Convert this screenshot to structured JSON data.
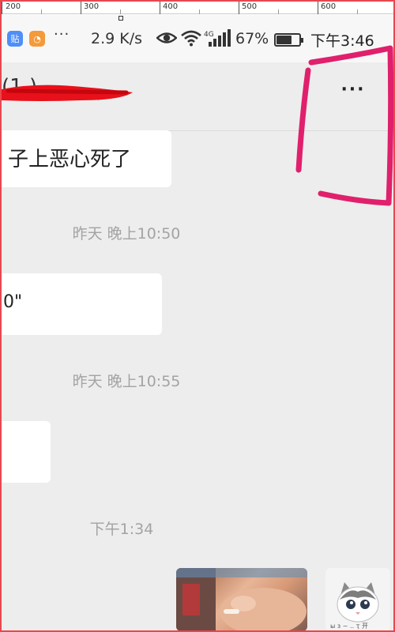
{
  "ruler": {
    "labels": [
      "200",
      "300",
      "400",
      "500",
      "600"
    ]
  },
  "status_bar": {
    "app_icons": [
      {
        "name": "tieba-app-icon",
        "glyph": "贴",
        "color": "#4f8ef7"
      },
      {
        "name": "uc-browser-app-icon",
        "glyph": "◔",
        "color": "#f39a3a"
      }
    ],
    "more_notifications": "···",
    "network_speed": "2.9 K/s",
    "network_type": "4G",
    "battery_percent": "67%",
    "battery_level": 0.67,
    "time": "下午3:46"
  },
  "title_bar": {
    "title": "(1 )",
    "more_label": "···"
  },
  "chat": {
    "messages": [
      {
        "text": "子上恶心死了"
      },
      {
        "text": "0\""
      },
      {
        "text": ""
      }
    ],
    "timestamps": [
      "昨天 晚上10:50",
      "昨天 晚上10:55",
      "下午1:34"
    ]
  },
  "colors": {
    "annotation": "#e0206c",
    "redaction": "#e8101a",
    "frame": "#e8474f",
    "chat_background": "#ededed"
  }
}
